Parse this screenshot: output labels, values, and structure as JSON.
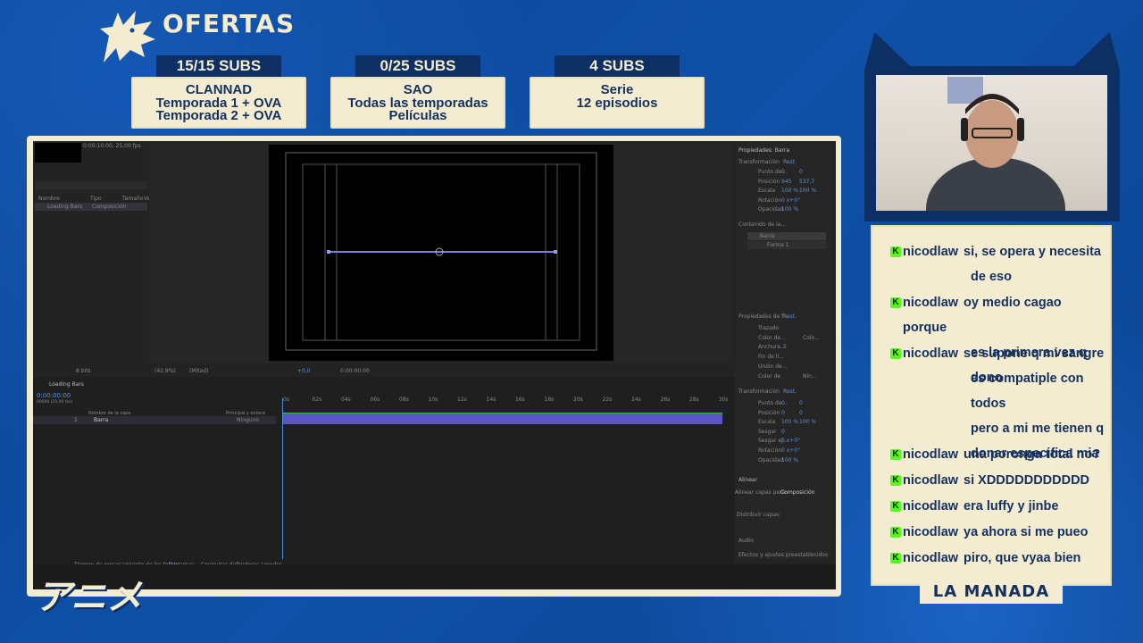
{
  "header": {
    "title": "OFERTAS"
  },
  "offers": [
    {
      "status": "15/15 SUBS",
      "line1": "CLANNAD",
      "line2": "Temporada 1 + OVA",
      "line3": "Temporada 2 + OVA"
    },
    {
      "status": "0/25 SUBS",
      "line1": "SAO",
      "line2": "Todas las temporadas",
      "line3": "Películas"
    },
    {
      "status": "4 SUBS",
      "line1": "Serie",
      "line2": "12 episodios",
      "line3": ""
    }
  ],
  "ae": {
    "project_info": "0:00:10:00, 25,00 fps",
    "project_cols": [
      "Nombre",
      "Tipo",
      "Tamaño",
      "Ve"
    ],
    "project_item": {
      "name": "Loading Bars",
      "type": "Composición"
    },
    "viewer_zoom": "(42,9%)",
    "viewer_res": "(Mitad)",
    "viewer_exposure": "+0,0",
    "viewer_time": "0:00:00:00",
    "bpc": "8 bits",
    "comp_tab": "Loading Bars",
    "timecode": "0:00:00:00",
    "timecode_sub": "00000 (25.00 fps)",
    "layer_cols": [
      "Nombre de la capa",
      "Principal y enlace"
    ],
    "layer": {
      "num": "1",
      "name": "Barra",
      "parent": "Ninguno"
    },
    "ruler": [
      "0s",
      "02s",
      "04s",
      "06s",
      "08s",
      "10s",
      "12s",
      "14s",
      "16s",
      "18s",
      "20s",
      "22s",
      "24s",
      "26s",
      "28s",
      "30s"
    ],
    "footer_left": "Tiempo de procesamiento de los fotogramas:",
    "footer_ms": "0ms",
    "footer_mid": "Conmutar definidores / modos",
    "props": {
      "title": "Propiedades: Barra",
      "section1": "Transformación",
      "reset": "Rest.",
      "rows1": [
        {
          "label": "Punto de...",
          "v1": "0",
          "v2": "0"
        },
        {
          "label": "Posición",
          "v1": "945",
          "v2": "537,7"
        },
        {
          "label": "Escala",
          "v1": "100 %",
          "v2": "100 %"
        },
        {
          "label": "Rotación",
          "v1": "0 x+0°",
          "v2": ""
        },
        {
          "label": "Opacidad",
          "v1": "100 %",
          "v2": ""
        }
      ],
      "contents_title": "Contenido de la...",
      "content_items": [
        "Barra",
        "Forma 1"
      ],
      "section2": "Propiedades de f...",
      "rows2": [
        "Trazado",
        "Color de...",
        "Anchura...",
        "Fin de lí...",
        "Unión de...",
        "Color de"
      ],
      "color_label": "Colo...",
      "none_label": "Nin...",
      "width_val": "5",
      "section3": "Transformación",
      "rows3": [
        {
          "label": "Punto de...",
          "v1": "0",
          "v2": "0"
        },
        {
          "label": "Posición",
          "v1": "0",
          "v2": "0"
        },
        {
          "label": "Escala",
          "v1": "100 %",
          "v2": "100 %"
        },
        {
          "label": "Sesgar",
          "v1": "0",
          "v2": ""
        },
        {
          "label": "Sesgar ej...",
          "v1": "0 x+0°",
          "v2": ""
        },
        {
          "label": "Rotación",
          "v1": "0 x+0°",
          "v2": ""
        },
        {
          "label": "Opacidad",
          "v1": "100 %",
          "v2": ""
        }
      ],
      "align_title": "Alinear",
      "align_to_label": "Alinear capas para:",
      "align_to_value": "Composición",
      "distribute": "Distribuir capas:",
      "audio": "Audio",
      "effects": "Efectos y ajustes preestablecidos"
    }
  },
  "chat": {
    "messages": [
      {
        "user": "nicodlaw",
        "lines": [
          "si, se opera y necesita",
          "de eso"
        ]
      },
      {
        "user": "nicodlaw",
        "lines": [
          "oy medio cagao porque",
          "es la primera vez q dono"
        ]
      },
      {
        "user": "nicodlaw",
        "lines": [
          "se supone q mi sangre",
          "es compatiple con todos",
          "pero a mi me tienen q",
          "donar especifica mia"
        ]
      },
      {
        "user": "nicodlaw",
        "lines": [
          "una poronga total no?"
        ]
      },
      {
        "user": "nicodlaw",
        "lines": [
          "si XDDDDDDDDDDD"
        ]
      },
      {
        "user": "nicodlaw",
        "lines": [
          "era luffy y jinbe"
        ]
      },
      {
        "user": "nicodlaw",
        "lines": [
          "ya ahora si me pueo"
        ]
      },
      {
        "user": "nicodlaw",
        "lines": [
          "piro, que vyaa bien"
        ]
      }
    ],
    "badge_letter": "K"
  },
  "footer_banner": "LA MANADA",
  "logo_text": "アニメ",
  "colors": {
    "navy": "#14305f",
    "cream": "#f4ecd0",
    "blue_bg": "#0e4a9e",
    "kick_green": "#53fc18",
    "layer_purple": "#5a54c4"
  }
}
